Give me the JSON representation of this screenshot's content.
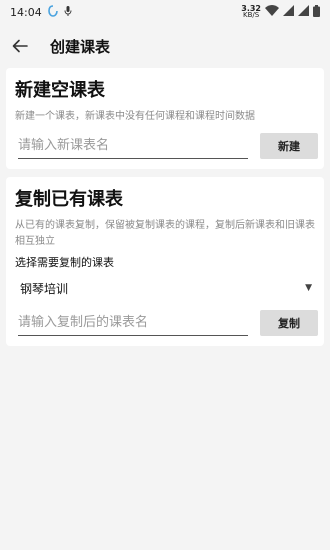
{
  "status": {
    "time": "14:04",
    "speed_value": "3.32",
    "speed_unit": "KB/S"
  },
  "appbar": {
    "title": "创建课表"
  },
  "new_card": {
    "title": "新建空课表",
    "desc": "新建一个课表，新课表中没有任何课程和课程时间数据",
    "input_placeholder": "请输入新课表名",
    "button_label": "新建"
  },
  "copy_card": {
    "title": "复制已有课表",
    "desc": "从已有的课表复制，保留被复制课表的课程，复制后新课表和旧课表相互独立",
    "select_label": "选择需要复制的课表",
    "selected_value": "钢琴培训",
    "input_placeholder": "请输入复制后的课表名",
    "button_label": "复制"
  }
}
